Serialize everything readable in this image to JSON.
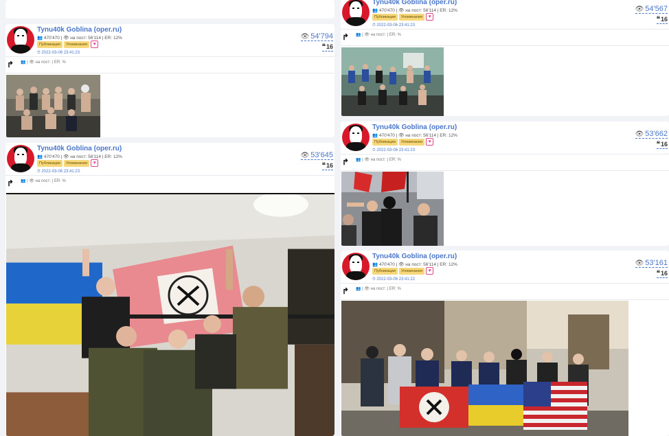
{
  "posts": [
    {
      "channel": "Tynu40k Goblina (oper.ru)",
      "meta": "👥 470'470 | 👁 на пост: 56'114 | ER: 12%",
      "tag_publications": "Публикации",
      "tag_mentions": "Упоминания",
      "date": "⏱ 2022-03-06 23:41:23",
      "views": "54'794",
      "quotes": "16",
      "submeta": "👥 | 👁 на пост: | ER: %"
    },
    {
      "channel": "Tynu40k Goblina (oper.ru)",
      "meta": "👥 470'470 | 👁 на пост: 56'114 | ER: 12%",
      "tag_publications": "Публикации",
      "tag_mentions": "Упоминания",
      "date": "⏱ 2022-03-06 23:41:23",
      "views": "53'645",
      "quotes": "16",
      "submeta": "👥 | 👁 на пост: | ER: %"
    },
    {
      "channel": "Tynu40k Goblina (oper.ru)",
      "meta": "👥 470'470 | 👁 на пост: 56'114 | ER: 12%",
      "tag_publications": "Публикации",
      "tag_mentions": "Упоминания",
      "date": "⏱ 2022-03-06 23:41:23",
      "views": "54'567",
      "quotes": "16",
      "submeta": "👥 | 👁 на пост: | ER: %"
    },
    {
      "channel": "Tynu40k Goblina (oper.ru)",
      "meta": "👥 470'470 | 👁 на пост: 56'114 | ER: 12%",
      "tag_publications": "Публикации",
      "tag_mentions": "Упоминания",
      "date": "⏱ 2022-03-06 23:41:23",
      "views": "53'662",
      "quotes": "16",
      "submeta": "👥 | 👁 на пост: | ER: %"
    },
    {
      "channel": "Tynu40k Goblina (oper.ru)",
      "meta": "👥 470'470 | 👁 на пост: 56'114 | ER: 12%",
      "tag_publications": "Публикации",
      "tag_mentions": "Упоминания",
      "date": "⏱ 2022-03-06 23:41:22",
      "views": "53'161",
      "quotes": "16",
      "submeta": "👥 | 👁 на пост: | ER: %"
    }
  ],
  "icons": {
    "eye": "eye-icon",
    "quote": "quote-icon",
    "repost": "repost-arrow-icon",
    "heart": "heart-icon",
    "avatar": "channel-avatar"
  },
  "colors": {
    "link": "#4a76c9",
    "tag_bg": "#f6d77a",
    "heart": "#e0458a",
    "avatar_bg": "#d8182b"
  }
}
